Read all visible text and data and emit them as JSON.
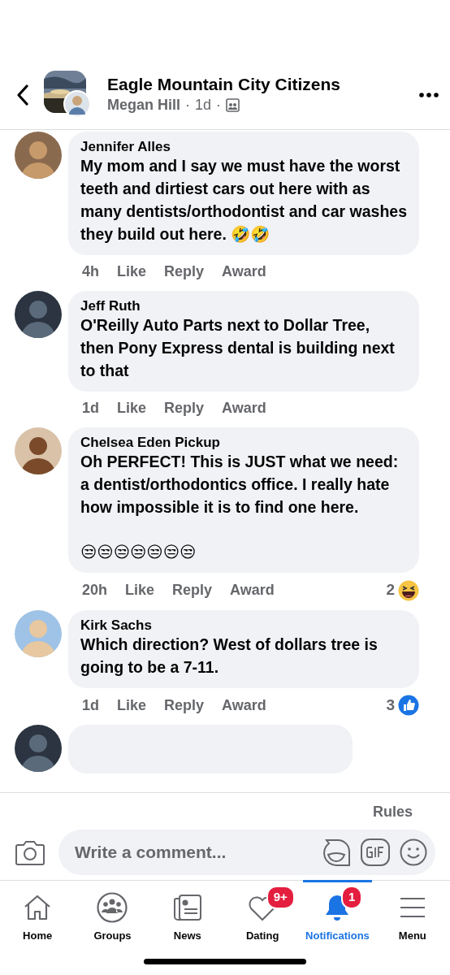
{
  "header": {
    "group_name": "Eagle Mountain City Citizens",
    "author": "Megan Hill",
    "time": "1d",
    "separators": [
      "·",
      "·"
    ]
  },
  "comments": [
    {
      "author": "Jennifer Alles",
      "text": "My mom and I say we must have the worst teeth and dirtiest cars out here with as many dentists/orthodontist and car washes they build out here. 🤣🤣",
      "time": "4h",
      "actions": [
        "Like",
        "Reply",
        "Award"
      ]
    },
    {
      "author": "Jeff Ruth",
      "text": "O'Reilly Auto Parts next to Dollar Tree, then Pony Express dental is building next to that",
      "time": "1d",
      "actions": [
        "Like",
        "Reply",
        "Award"
      ]
    },
    {
      "author": "Chelsea Eden Pickup",
      "text": "Oh PERFECT! This is JUST what we need: a dentist/orthodontics office. I really hate how impossible it is to find one here.\n\n😒😒😒😒😒😒😒",
      "time": "20h",
      "actions": [
        "Like",
        "Reply",
        "Award"
      ],
      "reactions": {
        "count": "2",
        "kind": "haha"
      }
    },
    {
      "author": "Kirk Sachs",
      "text": "Which direction? West of dollars tree is going to be a 7-11.",
      "time": "1d",
      "actions": [
        "Like",
        "Reply",
        "Award"
      ],
      "reactions": {
        "count": "3",
        "kind": "like"
      }
    }
  ],
  "composer": {
    "rules": "Rules",
    "placeholder": "Write a comment..."
  },
  "tabs": [
    {
      "label": "Home",
      "kind": "home",
      "selected": false
    },
    {
      "label": "Groups",
      "kind": "groups",
      "selected": false
    },
    {
      "label": "News",
      "kind": "news",
      "selected": false
    },
    {
      "label": "Dating",
      "kind": "dating",
      "selected": false,
      "badge": "9+"
    },
    {
      "label": "Notifications",
      "kind": "bell",
      "selected": true,
      "badge": "1"
    },
    {
      "label": "Menu",
      "kind": "menu",
      "selected": false
    }
  ]
}
